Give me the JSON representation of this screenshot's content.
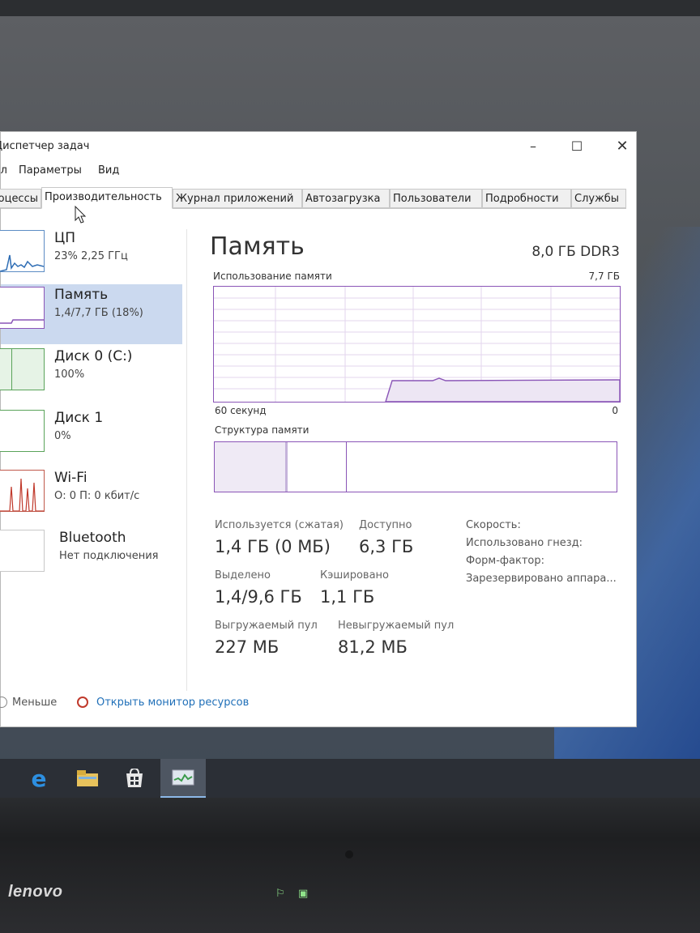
{
  "window": {
    "title": "Диспетчер задач",
    "controls": {
      "minimize": "–",
      "maximize": "☐",
      "close": "✕"
    }
  },
  "menu": [
    "Файл",
    "Параметры",
    "Вид"
  ],
  "tabs": [
    {
      "label": "Процессы"
    },
    {
      "label": "Производительность",
      "active": true
    },
    {
      "label": "Журнал приложений"
    },
    {
      "label": "Автозагрузка"
    },
    {
      "label": "Пользователи"
    },
    {
      "label": "Подробности"
    },
    {
      "label": "Службы"
    }
  ],
  "sidebar": {
    "items": [
      {
        "title": "ЦП",
        "sub": "23% 2,25 ГГц"
      },
      {
        "title": "Память",
        "sub": "1,4/7,7 ГБ (18%)",
        "selected": true
      },
      {
        "title": "Диск 0 (C:)",
        "sub": "100%"
      },
      {
        "title": "Диск 1",
        "sub": "0%"
      },
      {
        "title": "Wi-Fi",
        "sub": "О: 0 П: 0 кбит/с"
      },
      {
        "title": "Bluetooth",
        "sub": "Нет подключения"
      }
    ]
  },
  "main": {
    "title": "Память",
    "spec": "8,0 ГБ DDR3",
    "usage_label": "Использование памяти",
    "usage_max": "7,7 ГБ",
    "axis_left": "60 секунд",
    "axis_right": "0",
    "structure_label": "Структура памяти",
    "usage_fraction": 0.18
  },
  "stats": {
    "in_use_label": "Используется (сжатая)",
    "in_use_value": "1,4 ГБ (0 МБ)",
    "available_label": "Доступно",
    "available_value": "6,3 ГБ",
    "committed_label": "Выделено",
    "committed_value": "1,4/9,6 ГБ",
    "cached_label": "Кэшировано",
    "cached_value": "1,1 ГБ",
    "paged_label": "Выгружаемый пул",
    "paged_value": "227 МБ",
    "nonpaged_label": "Невыгружаемый пул",
    "nonpaged_value": "81,2 МБ"
  },
  "info": {
    "speed": "Скорость:",
    "slots": "Использовано гнезд:",
    "form": "Форм-фактор:",
    "reserved": "Зарезервировано аппара..."
  },
  "footer": {
    "less": "Меньше",
    "monitor": "Открыть монитор ресурсов"
  },
  "taskbar": [
    "edge-icon",
    "file-explorer-icon",
    "store-icon",
    "task-manager-icon"
  ],
  "hardware": {
    "brand": "lenovo"
  },
  "colors": {
    "accent_memory": "#8a55b7",
    "selected_bg": "#cbd9ef",
    "link": "#1f6fb8"
  }
}
